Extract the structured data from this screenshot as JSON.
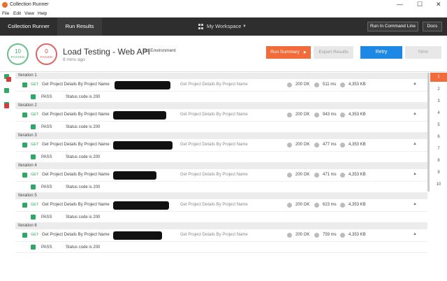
{
  "window": {
    "title": "Collection Runner",
    "minimize": "—",
    "maximize": "☐",
    "close": "✕"
  },
  "menu": [
    "File",
    "Edit",
    "View",
    "Help"
  ],
  "nav": {
    "tab_runner": "Collection Runner",
    "tab_results": "Run Results",
    "workspace": "My Workspace",
    "cmdline": "Run In Command Line",
    "docs": "Docs"
  },
  "header": {
    "passed": "10",
    "passed_label": "PASSED",
    "failed": "0",
    "failed_label": "FAILED",
    "title": "Load Testing - Web API",
    "environment": "No Environment",
    "time": "8 mins ago",
    "summary": "Run Summary",
    "export": "Export Results",
    "retry": "Retry",
    "new": "New"
  },
  "iterations": [
    {
      "label": "Iteration 1",
      "method": "GET",
      "name": "Get Project Details By Project Name",
      "desc": "Get Project Details By Project Name",
      "status": "200 OK",
      "time": "511 ms",
      "size": "4,353 KB",
      "test_result": "PASS",
      "test_name": "Status code is 200"
    },
    {
      "label": "Iteration 2",
      "method": "GET",
      "name": "Get Project Details By Project Name",
      "desc": "Get Project Details By Project Name",
      "status": "200 OK",
      "time": "943 ms",
      "size": "4,353 KB",
      "test_result": "PASS",
      "test_name": "Status code is 200"
    },
    {
      "label": "Iteration 3",
      "method": "GET",
      "name": "Get Project Details By Project Name",
      "desc": "Get Project Details By Project Name",
      "status": "200 OK",
      "time": "477 ms",
      "size": "4,353 KB",
      "test_result": "PASS",
      "test_name": "Status code is 200"
    },
    {
      "label": "Iteration 4",
      "method": "GET",
      "name": "Get Project Details By Project Name",
      "desc": "Get Project Details By Project Name",
      "status": "200 OK",
      "time": "471 ms",
      "size": "4,353 KB",
      "test_result": "PASS",
      "test_name": "Status code is 200"
    },
    {
      "label": "Iteration 5",
      "method": "GET",
      "name": "Get Project Details By Project Name",
      "desc": "Get Project Details By Project Name",
      "status": "200 OK",
      "time": "623 ms",
      "size": "4,353 KB",
      "test_result": "PASS",
      "test_name": "Status code is 200"
    },
    {
      "label": "Iteration 6",
      "method": "GET",
      "name": "Get Project Details By Project Name",
      "desc": "Get Project Details By Project Name",
      "status": "200 OK",
      "time": "759 ms",
      "size": "4,353 KB",
      "test_result": "PASS",
      "test_name": "Status code is 200"
    }
  ],
  "pages": [
    "1",
    "2",
    "3",
    "4",
    "5",
    "6",
    "7",
    "8",
    "9",
    "10"
  ],
  "colors": {
    "pass_green": "#2fa866",
    "fail_red": "#d63c3c",
    "accent_orange": "#f26b3a",
    "retry_blue": "#1e88e5",
    "nav_bg": "#2e2e2e"
  }
}
